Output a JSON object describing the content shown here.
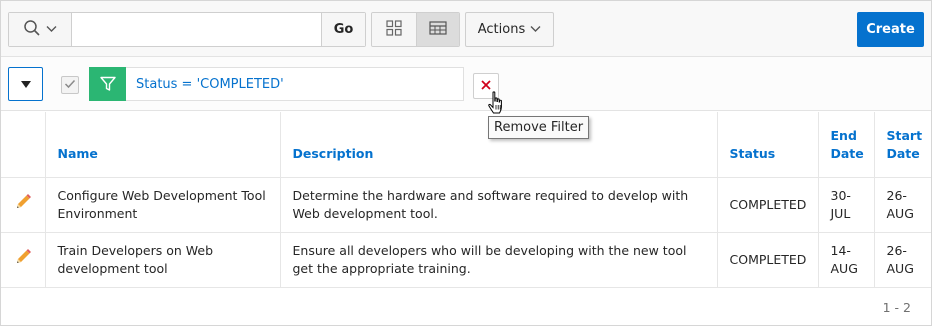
{
  "toolbar": {
    "search_placeholder": "",
    "go_label": "Go",
    "actions_label": "Actions",
    "create_label": "Create"
  },
  "filter": {
    "text": "Status = 'COMPLETED'",
    "tooltip": "Remove Filter"
  },
  "table": {
    "headers": {
      "name": "Name",
      "description": "Description",
      "status": "Status",
      "end_date": "End Date",
      "start_date": "Start Date"
    },
    "rows": [
      {
        "name": "Configure Web Development Tool Environment",
        "description": "Determine the hardware and software required to develop with Web development tool.",
        "status": "COMPLETED",
        "end_date": "30-JUL",
        "start_date": "26-AUG"
      },
      {
        "name": "Train Developers on Web development tool",
        "description": "Ensure all developers who will be developing with the new tool get the appropriate training.",
        "status": "COMPLETED",
        "end_date": "14-AUG",
        "start_date": "26-AUG"
      }
    ]
  },
  "pagination": "1 - 2",
  "colors": {
    "accent": "#0572ce",
    "filter_green": "#2bb673",
    "remove_red": "#d0021b",
    "edit_orange": "#f0a030"
  }
}
